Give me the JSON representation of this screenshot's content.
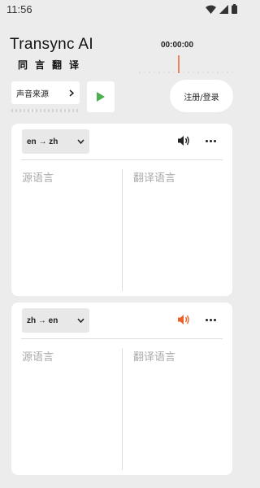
{
  "status": {
    "time": "11:56"
  },
  "brand": {
    "title": "Transync AI",
    "subtitle": "同言翻译"
  },
  "recorder": {
    "timer": "00:00:00"
  },
  "controls": {
    "source_label": "声音来源",
    "login_label": "注册/登录"
  },
  "cards": [
    {
      "lang_pair": "en → zh",
      "source_placeholder": "源语言",
      "target_placeholder": "翻译语言",
      "speaker_color": "#222222"
    },
    {
      "lang_pair": "zh → en",
      "source_placeholder": "源语言",
      "target_placeholder": "翻译语言",
      "speaker_color": "#e8622c"
    }
  ],
  "colors": {
    "accent": "#e8622c",
    "play": "#4caf50",
    "background": "#ececec"
  }
}
